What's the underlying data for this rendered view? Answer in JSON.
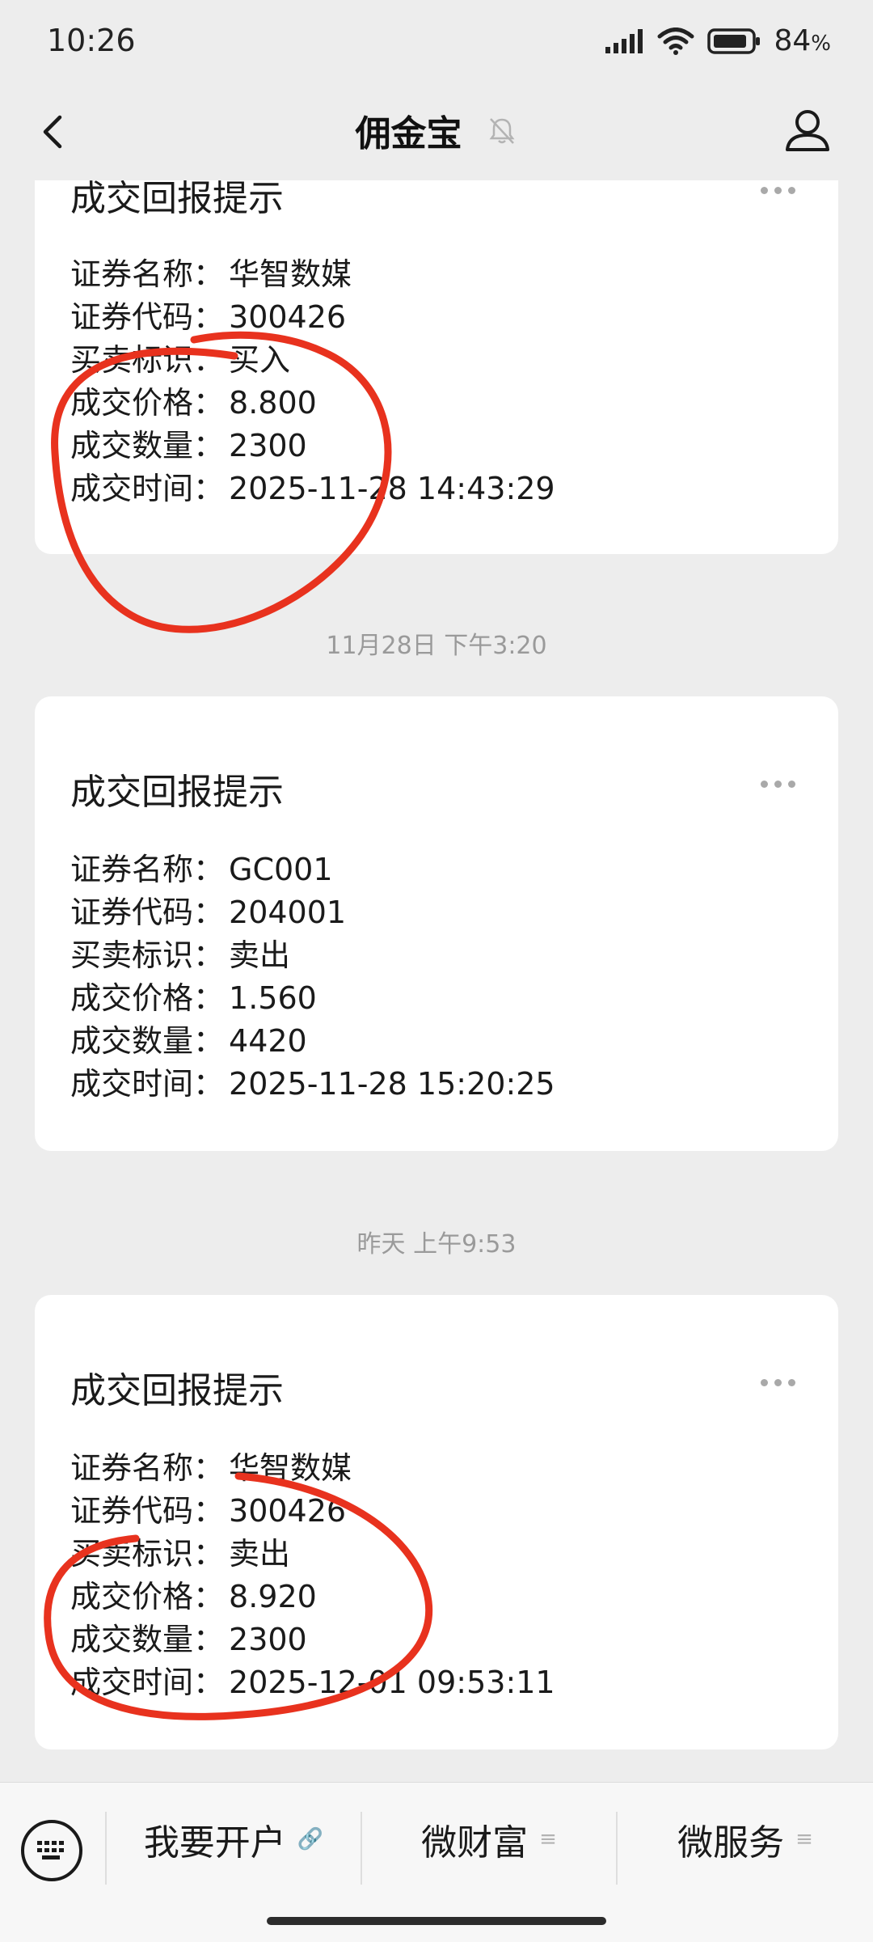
{
  "status_bar": {
    "time": "10:26",
    "battery": "84",
    "battery_unit": "%"
  },
  "header": {
    "title": "佣金宝"
  },
  "messages": [
    {
      "title": "成交回报提示",
      "rows": [
        {
          "label": "证券名称：",
          "value": "华智数媒"
        },
        {
          "label": "证券代码：",
          "value": "300426"
        },
        {
          "label": "买卖标识：",
          "value": "买入"
        },
        {
          "label": "成交价格：",
          "value": "8.800"
        },
        {
          "label": "成交数量：",
          "value": "2300"
        },
        {
          "label": "成交时间：",
          "value": "2025-11-28 14:43:29"
        }
      ]
    },
    {
      "timestamp": "11月28日 下午3:20",
      "title": "成交回报提示",
      "rows": [
        {
          "label": "证券名称：",
          "value": "GC001"
        },
        {
          "label": "证券代码：",
          "value": "204001"
        },
        {
          "label": "买卖标识：",
          "value": "卖出"
        },
        {
          "label": "成交价格：",
          "value": "1.560"
        },
        {
          "label": "成交数量：",
          "value": "4420"
        },
        {
          "label": "成交时间：",
          "value": "2025-11-28 15:20:25"
        }
      ]
    },
    {
      "timestamp": "昨天 上午9:53",
      "title": "成交回报提示",
      "rows": [
        {
          "label": "证券名称：",
          "value": "华智数媒"
        },
        {
          "label": "证券代码：",
          "value": "300426"
        },
        {
          "label": "买卖标识：",
          "value": "卖出"
        },
        {
          "label": "成交价格：",
          "value": "8.920"
        },
        {
          "label": "成交数量：",
          "value": "2300"
        },
        {
          "label": "成交时间：",
          "value": "2025-12-01 09:53:11"
        }
      ]
    }
  ],
  "bottom_menu": [
    {
      "label": "我要开户",
      "icon": "link-icon"
    },
    {
      "label": "微财富",
      "icon": "menu-lines-icon"
    },
    {
      "label": "微服务",
      "icon": "menu-lines-icon"
    }
  ],
  "colors": {
    "background": "#ededed",
    "card": "#ffffff",
    "annotation": "#e8321e"
  }
}
